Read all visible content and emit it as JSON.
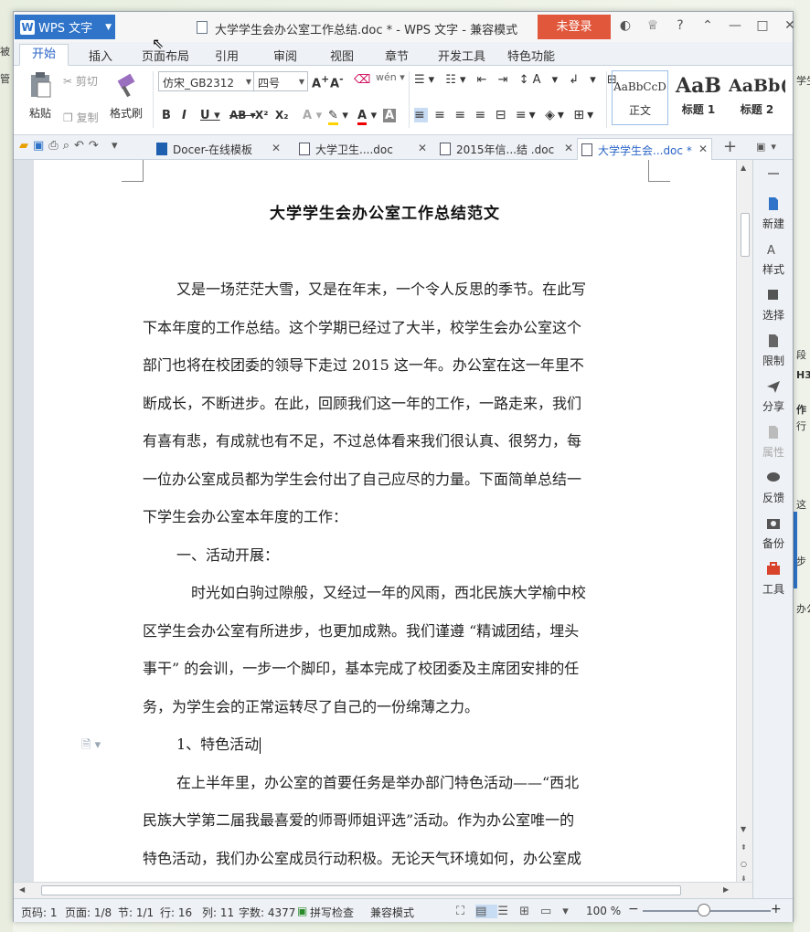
{
  "window": {
    "app_name": "WPS 文字",
    "title": "大学学生会办公室工作总结.doc * - WPS 文字 - 兼容模式",
    "login": "未登录"
  },
  "menu": [
    "开始",
    "插入",
    "页面布局",
    "引用",
    "审阅",
    "视图",
    "章节",
    "开发工具",
    "特色功能"
  ],
  "ribbon": {
    "paste": "粘贴",
    "cut": "剪切",
    "copy": "复制",
    "format_painter": "格式刷",
    "font_name": "仿宋_GB2312",
    "font_size": "四号",
    "styles": [
      {
        "sample": "AaBbCcD",
        "label": "正文"
      },
      {
        "sample": "AaB",
        "label": "标题 1"
      },
      {
        "sample": "AaBb(",
        "label": "标题 2"
      }
    ]
  },
  "doc_tabs": [
    {
      "label": "Docer-在线模板",
      "active": false
    },
    {
      "label": "大学卫生....doc",
      "active": false
    },
    {
      "label": "2015年信...结 .doc",
      "active": false
    },
    {
      "label": "大学学生会...doc *",
      "active": true
    }
  ],
  "document": {
    "title": "大学学生会办公室工作总结范文",
    "lines": [
      "又是一场茫茫大雪，又是在年末，一个令人反思的季节。在此写",
      "下本年度的工作总结。这个学期已经过了大半，校学生会办公室这个",
      "部门也将在校团委的领导下走过 2015 这一年。办公室在这一年里不",
      "断成长，不断进步。在此，回顾我们这一年的工作，一路走来，我们",
      "有喜有悲，有成就也有不足，不过总体看来我们很认真、很努力，每",
      "一位办公室成员都为学生会付出了自己应尽的力量。下面简单总结一",
      "下学生会办公室本年度的工作：",
      "一、活动开展：",
      "时光如白驹过隙般，又经过一年的风雨，西北民族大学榆中校",
      "区学生会办公室有所进步，也更加成熟。我们谨遵 “精诚团结，埋头",
      "事干” 的会训，一步一个脚印，基本完成了校团委及主席团安排的任",
      "务，为学生会的正常运转尽了自己的一份绵薄之力。",
      "1、特色活动",
      "在上半年里，办公室的首要任务是举办部门特色活动——“西北",
      "民族大学第二届我最喜爱的师哥师姐评选”活动。作为办公室唯一的",
      "特色活动，我们办公室成员行动积极。无论天气环境如何，办公室成"
    ]
  },
  "side_panel": [
    "新建",
    "样式",
    "选择",
    "限制",
    "分享",
    "属性",
    "反馈",
    "备份",
    "工具"
  ],
  "status": {
    "page_num": "页码: 1",
    "pages": "页面: 1/8",
    "section": "节: 1/1",
    "line": "行: 16",
    "column": "列: 11",
    "word_count": "字数: 4377",
    "spell_check": "拼写检查",
    "compat": "兼容模式",
    "zoom": "100 %"
  },
  "background_text": {
    "left": [
      "被",
      "管"
    ],
    "right": [
      "学生",
      "段",
      "H3",
      "作",
      "行",
      "这",
      "步",
      "办公"
    ]
  },
  "colors": {
    "accent_blue": "#2f74c9",
    "login_red": "#e1573b"
  }
}
